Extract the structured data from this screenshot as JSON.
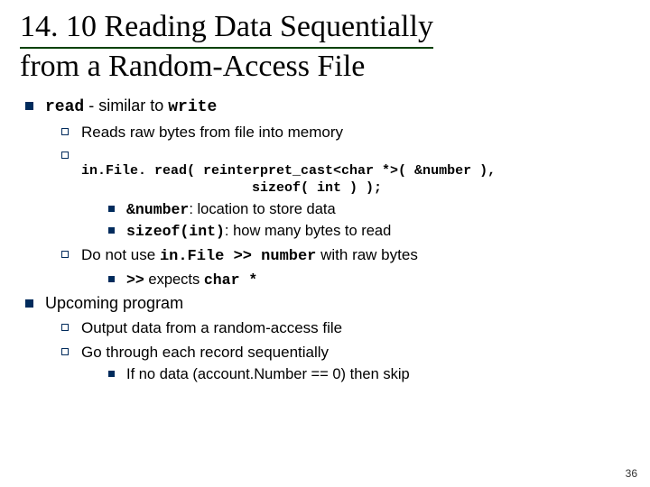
{
  "slide": {
    "title_num": "14. 10",
    "title_line1": "  Reading Data Sequentially",
    "title_line2": "from a Random-Access File",
    "b1_pre": "read",
    "b1_mid": " - similar to ",
    "b1_post": "write",
    "b1a": "Reads raw bytes from file into memory",
    "code1": "in.File. read( reinterpret_cast<char *>( &number ),",
    "code2": "                     sizeof( int ) );",
    "b1b_i_pre": "&number",
    "b1b_i_post": ": location to store data",
    "b1b_ii_pre": "sizeof(int)",
    "b1b_ii_post": ": how many bytes to read",
    "b1c_pre": "Do not use ",
    "b1c_mid": "in.File >> number",
    "b1c_post": " with raw bytes",
    "b1c_i_pre": ">>",
    "b1c_i_mid": " expects ",
    "b1c_i_post": "char *",
    "b2": "Upcoming program",
    "b2a": "Output data from a random-access file",
    "b2b": "Go through each record sequentially",
    "b2b_i": "If no data (account.Number == 0) then skip",
    "pagenum": "36"
  }
}
